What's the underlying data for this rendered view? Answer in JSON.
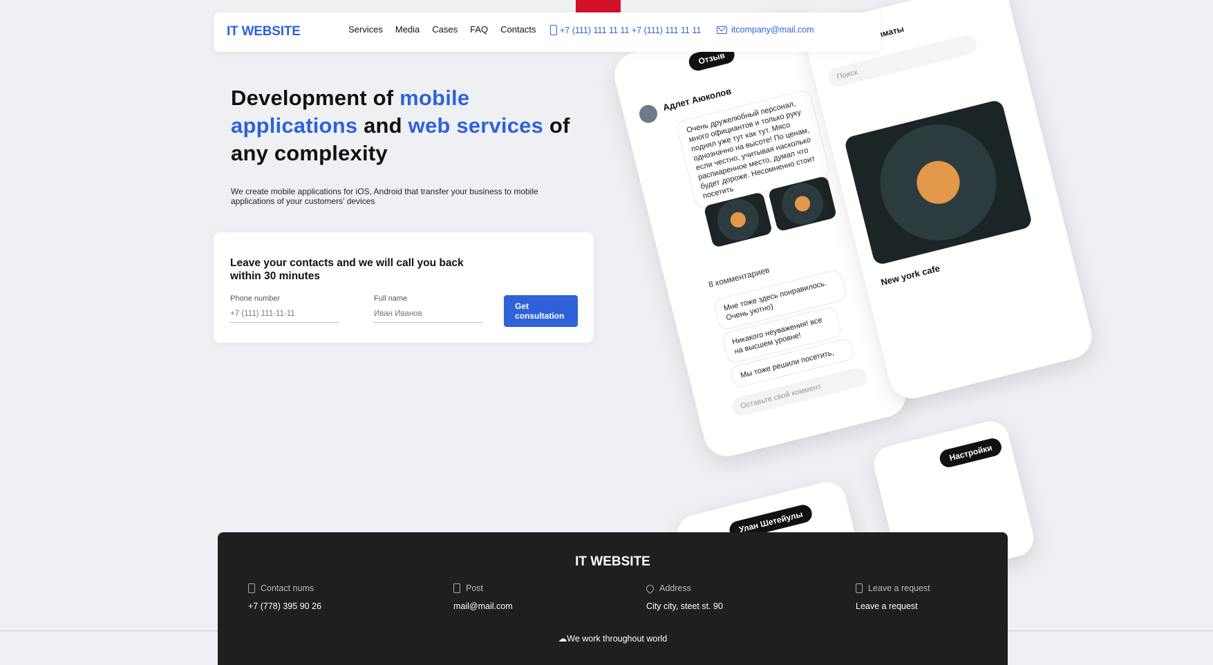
{
  "header": {
    "logo": "IT WEBSITE",
    "nav": [
      "Services",
      "Media",
      "Cases",
      "FAQ",
      "Contacts"
    ],
    "phones": "+7 (111) 111 11 11 +7 (111) 111 11 11",
    "email": "itcompany@mail.com"
  },
  "hero": {
    "title_part1": "Development of ",
    "title_accent1": "mobile applications",
    "title_part2": " and ",
    "title_accent2": "web services",
    "title_part3": " of any complexity",
    "subtitle": "We create mobile applications for iOS, Android that transfer your business to mobile applications of your customers' devices"
  },
  "form": {
    "title": "Leave your contacts and we will call you back within 30 minutes",
    "phone_label": "Phone number",
    "phone_placeholder": "+7 (111) 111-11-11",
    "name_label": "Full name",
    "name_placeholder": "Иван Иванов",
    "button": "Get consultation"
  },
  "mockups": {
    "review_pill": "Отзыв",
    "reviewer": "Адлет Аюколов",
    "review_text": "Очень дружелюбный персонал, много официантов и только руку поднял уже тут как тут. Мясо однозначно на высоте! По ценам, если честно, учитывая насколько распиаренное место, думал что будет дороже. Несомненно стоит посетить",
    "comments_count": "8 комментариев",
    "comment1": "Мне тоже здесь понравилось. Очень уютно)",
    "comment2": "Никакого неуважения! все на высшем уровне!",
    "comment3": "Мы тоже решили посетить,",
    "comment_placeholder": "Оставьте свой коммент",
    "city": "Алматы",
    "search": "Поиск",
    "cafe": "New york cafe",
    "settings_pill": "Настройки",
    "user_pill": "Улан Шетейулы"
  },
  "footer": {
    "logo": "IT WEBSITE",
    "cols": [
      {
        "head": "Contact nums",
        "val": "+7 (778) 395 90 26"
      },
      {
        "head": "Post",
        "val": "mail@mail.com"
      },
      {
        "head": "Address",
        "val": "City city, steet st. 90"
      },
      {
        "head": "Leave a request",
        "val": "Leave a request"
      }
    ],
    "note": "We work throughout world"
  }
}
